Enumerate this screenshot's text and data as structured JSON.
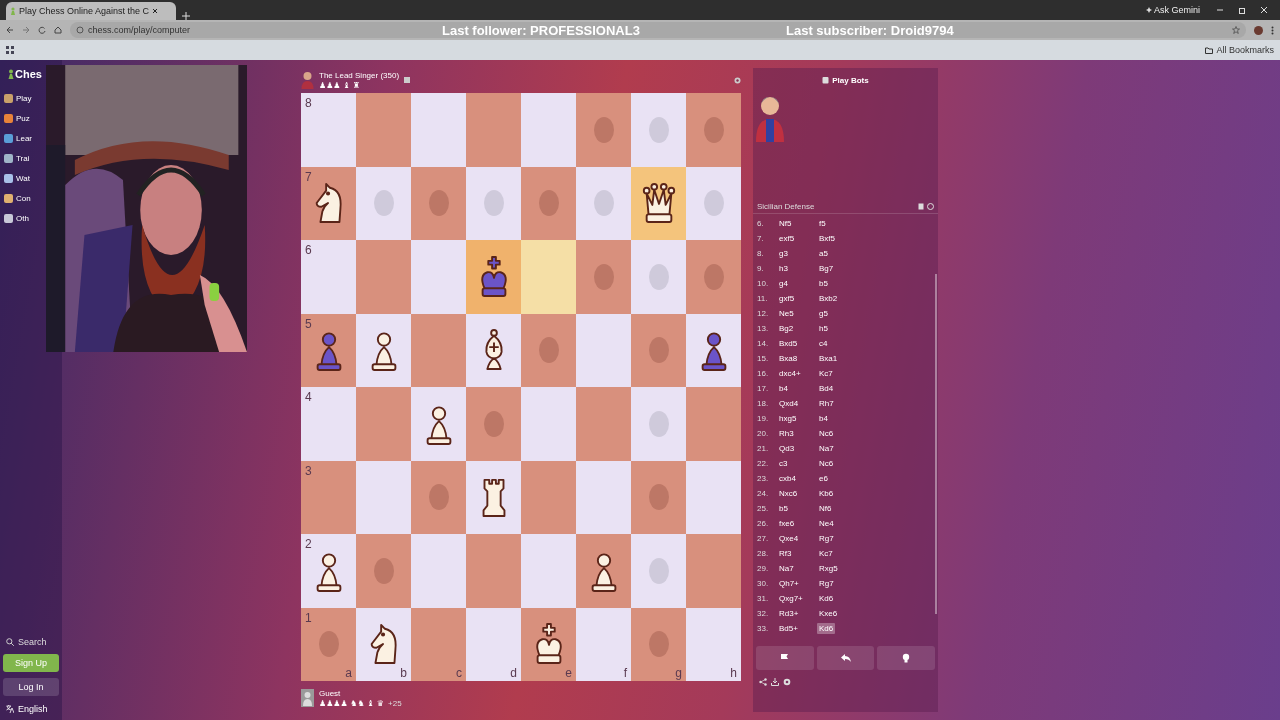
{
  "browser": {
    "tab_title": "Play Chess Online Against the C",
    "url": "chess.com/play/computer",
    "assistant": "Ask Gemini",
    "bookmarks": "All Bookmarks"
  },
  "stream_overlay": {
    "follower": "Last follower: PROFESSIONAL3",
    "subscriber": "Last subscriber: Droid9794"
  },
  "sidebar": {
    "logo": "Ches",
    "items": [
      {
        "label": "Play",
        "color": "#c9a06a"
      },
      {
        "label": "Puz",
        "color": "#e8823a"
      },
      {
        "label": "Lear",
        "color": "#5a9ed8"
      },
      {
        "label": "Trai",
        "color": "#9fb4c8"
      },
      {
        "label": "Wat",
        "color": "#a8c0e8"
      },
      {
        "label": "Con",
        "color": "#e0b070"
      },
      {
        "label": "Oth",
        "color": "#c8c8d8"
      }
    ],
    "search": "Search",
    "sign_up": "Sign Up",
    "log_in": "Log In",
    "language": "English"
  },
  "opponent": {
    "name": "The Lead Singer",
    "rating": "(350)",
    "captured": "♟♟♟ ♝ ♜"
  },
  "player": {
    "name": "Guest",
    "captured": "♟♟♟♟ ♞♞ ♝ ♛",
    "advantage": "+25"
  },
  "board": {
    "rank_labels": [
      "8",
      "7",
      "6",
      "5",
      "4",
      "3",
      "2",
      "1"
    ],
    "file_labels": [
      "a",
      "b",
      "c",
      "d",
      "e",
      "f",
      "g",
      "h"
    ],
    "squares": [
      {
        "hint": false,
        "highlighted": false
      },
      {
        "hint": false,
        "highlighted": false
      },
      {
        "hint": false,
        "highlighted": false
      },
      {
        "hint": false,
        "highlighted": false
      },
      {
        "hint": false,
        "highlighted": false
      },
      {
        "hint": true,
        "highlighted": false
      },
      {
        "hint": true,
        "highlighted": false
      },
      {
        "hint": true,
        "highlighted": false
      },
      {
        "piece": {
          "kind": "knight",
          "color": "#fbf1e2"
        },
        "hint": false,
        "highlighted": false
      },
      {
        "hint": true,
        "highlighted": false
      },
      {
        "hint": true,
        "highlighted": false
      },
      {
        "hint": true,
        "highlighted": false
      },
      {
        "hint": true,
        "highlighted": false
      },
      {
        "hint": true,
        "highlighted": false
      },
      {
        "piece": {
          "kind": "queen",
          "color": "#fbf1e2"
        },
        "hint": false,
        "highlighted": true,
        "color": "#f4c47c"
      },
      {
        "hint": true,
        "highlighted": false
      },
      {
        "hint": false,
        "highlighted": false
      },
      {
        "hint": false,
        "highlighted": false
      },
      {
        "hint": false,
        "highlighted": false
      },
      {
        "piece": {
          "kind": "king",
          "color": "#6b54c8"
        },
        "hint": false,
        "highlighted": true,
        "color": "#f0b26c"
      },
      {
        "hint": false,
        "highlighted": true,
        "color": "#f5dfa6"
      },
      {
        "hint": true,
        "highlighted": false
      },
      {
        "hint": true,
        "highlighted": false
      },
      {
        "hint": true,
        "highlighted": false
      },
      {
        "piece": {
          "kind": "pawn",
          "color": "#6b54c8"
        },
        "hint": false,
        "highlighted": false
      },
      {
        "piece": {
          "kind": "pawn",
          "color": "#fbf1e2"
        },
        "hint": false,
        "highlighted": false
      },
      {
        "hint": false,
        "highlighted": false
      },
      {
        "piece": {
          "kind": "bishop",
          "color": "#fbf1e2"
        },
        "hint": false,
        "highlighted": false
      },
      {
        "hint": true,
        "highlighted": false
      },
      {
        "hint": false,
        "highlighted": false
      },
      {
        "hint": true,
        "highlighted": false
      },
      {
        "piece": {
          "kind": "pawn",
          "color": "#6b54c8"
        },
        "hint": false,
        "highlighted": false
      },
      {
        "hint": false,
        "highlighted": false
      },
      {
        "hint": false,
        "highlighted": false
      },
      {
        "piece": {
          "kind": "pawn",
          "color": "#fbf1e2"
        },
        "hint": false,
        "highlighted": false
      },
      {
        "hint": true,
        "highlighted": false
      },
      {
        "hint": false,
        "highlighted": false
      },
      {
        "hint": false,
        "highlighted": false
      },
      {
        "hint": true,
        "highlighted": false
      },
      {
        "hint": false,
        "highlighted": false
      },
      {
        "hint": false,
        "highlighted": false
      },
      {
        "hint": false,
        "highlighted": false
      },
      {
        "hint": true,
        "highlighted": false
      },
      {
        "piece": {
          "kind": "rook",
          "color": "#fbf1e2"
        },
        "hint": false,
        "highlighted": false
      },
      {
        "hint": false,
        "highlighted": false
      },
      {
        "hint": false,
        "highlighted": false
      },
      {
        "hint": true,
        "highlighted": false
      },
      {
        "hint": false,
        "highlighted": false
      },
      {
        "piece": {
          "kind": "pawn",
          "color": "#fbf1e2"
        },
        "hint": false,
        "highlighted": false
      },
      {
        "hint": true,
        "highlighted": false
      },
      {
        "hint": false,
        "highlighted": false
      },
      {
        "hint": false,
        "highlighted": false
      },
      {
        "hint": false,
        "highlighted": false
      },
      {
        "piece": {
          "kind": "pawn",
          "color": "#fbf1e2"
        },
        "hint": false,
        "highlighted": false
      },
      {
        "hint": true,
        "highlighted": false
      },
      {
        "hint": false,
        "highlighted": false
      },
      {
        "hint": true,
        "highlighted": false
      },
      {
        "piece": {
          "kind": "knight",
          "color": "#fbf1e2"
        },
        "hint": false,
        "highlighted": false
      },
      {
        "hint": false,
        "highlighted": false
      },
      {
        "hint": false,
        "highlighted": false
      },
      {
        "piece": {
          "kind": "king",
          "color": "#fbf1e2"
        },
        "hint": false,
        "highlighted": false
      },
      {
        "hint": false,
        "highlighted": false
      },
      {
        "hint": true,
        "highlighted": false
      },
      {
        "hint": false,
        "highlighted": false
      }
    ]
  },
  "panel": {
    "title": "Play Bots",
    "opening": "Sicilian Defense",
    "moves": [
      {
        "number": "6.",
        "white": "Nf5",
        "black": "f5",
        "selected": false
      },
      {
        "number": "7.",
        "white": "exf5",
        "black": "Bxf5",
        "selected": false
      },
      {
        "number": "8.",
        "white": "g3",
        "black": "a5",
        "selected": false
      },
      {
        "number": "9.",
        "white": "h3",
        "black": "Bg7",
        "selected": false
      },
      {
        "number": "10.",
        "white": "g4",
        "black": "b5",
        "selected": false
      },
      {
        "number": "11.",
        "white": "gxf5",
        "black": "Bxb2",
        "selected": false
      },
      {
        "number": "12.",
        "white": "Ne5",
        "black": "g5",
        "selected": false
      },
      {
        "number": "13.",
        "white": "Bg2",
        "black": "h5",
        "selected": false
      },
      {
        "number": "14.",
        "white": "Bxd5",
        "black": "c4",
        "selected": false
      },
      {
        "number": "15.",
        "white": "Bxa8",
        "black": "Bxa1",
        "selected": false
      },
      {
        "number": "16.",
        "white": "dxc4+",
        "black": "Kc7",
        "selected": false
      },
      {
        "number": "17.",
        "white": "b4",
        "black": "Bd4",
        "selected": false
      },
      {
        "number": "18.",
        "white": "Qxd4",
        "black": "Rh7",
        "selected": false
      },
      {
        "number": "19.",
        "white": "hxg5",
        "black": "b4",
        "selected": false
      },
      {
        "number": "20.",
        "white": "Rh3",
        "black": "Nc6",
        "selected": false
      },
      {
        "number": "21.",
        "white": "Qd3",
        "black": "Na7",
        "selected": false
      },
      {
        "number": "22.",
        "white": "c3",
        "black": "Nc6",
        "selected": false
      },
      {
        "number": "23.",
        "white": "cxb4",
        "black": "e6",
        "selected": false
      },
      {
        "number": "24.",
        "white": "Nxc6",
        "black": "Kb6",
        "selected": false
      },
      {
        "number": "25.",
        "white": "b5",
        "black": "Nf6",
        "selected": false
      },
      {
        "number": "26.",
        "white": "fxe6",
        "black": "Ne4",
        "selected": false
      },
      {
        "number": "27.",
        "white": "Qxe4",
        "black": "Rg7",
        "selected": false
      },
      {
        "number": "28.",
        "white": "Rf3",
        "black": "Kc7",
        "selected": false
      },
      {
        "number": "29.",
        "white": "Na7",
        "black": "Rxg5",
        "selected": false
      },
      {
        "number": "30.",
        "white": "Qh7+",
        "black": "Rg7",
        "selected": false
      },
      {
        "number": "31.",
        "white": "Qxg7+",
        "black": "Kd6",
        "selected": false
      },
      {
        "number": "32.",
        "white": "Rd3+",
        "black": "Kxe6",
        "selected": false
      },
      {
        "number": "33.",
        "white": "Bd5+",
        "black": "Kd6",
        "selected": true
      }
    ]
  }
}
